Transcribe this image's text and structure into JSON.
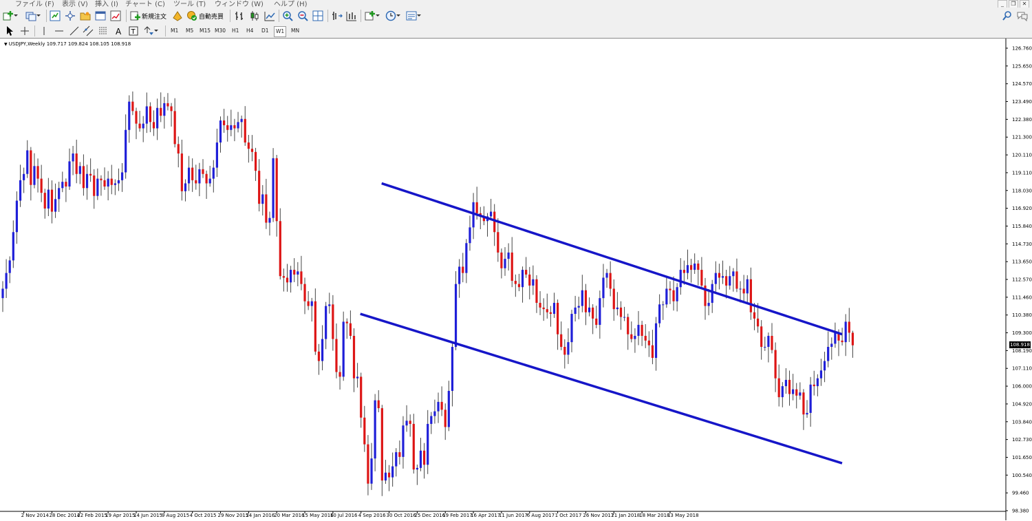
{
  "menu": [
    "ファイル (F)",
    "表示 (V)",
    "挿入 (I)",
    "チャート (C)",
    "ツール (T)",
    "ウィンドウ (W)",
    "ヘルプ (H)"
  ],
  "toolbar": {
    "new_order_label": "新規注文",
    "auto_trade_label": "自動売買"
  },
  "timeframes": [
    "M1",
    "M5",
    "M15",
    "M30",
    "H1",
    "H4",
    "D1",
    "W1",
    "MN"
  ],
  "active_timeframe": "W1",
  "chart_header": "USDJPY,Weekly  109.717 109.824 108.105 108.918",
  "current_price_label": "108.918",
  "colors": {
    "bull": "#1f1fd8",
    "bear": "#dd1515",
    "wick": "#444444",
    "channel": "#1616c8",
    "price_tag_bg": "#000000"
  },
  "chart_data": {
    "type": "candlestick",
    "symbol": "USDJPY",
    "timeframe": "Weekly",
    "last_bar": {
      "open": 109.717,
      "high": 109.824,
      "low": 108.105,
      "close": 108.918
    },
    "current_price": 108.918,
    "ylim": [
      98.38,
      127.8
    ],
    "y_ticks": [
      "126.760",
      "125.650",
      "124.570",
      "123.490",
      "122.380",
      "121.300",
      "120.110",
      "119.110",
      "118.030",
      "116.920",
      "115.840",
      "114.730",
      "113.650",
      "112.570",
      "111.460",
      "110.380",
      "109.300",
      "108.190",
      "107.110",
      "106.000",
      "104.920",
      "103.840",
      "102.730",
      "101.650",
      "100.540",
      "99.460",
      "98.380"
    ],
    "x_ticks": [
      "2 Nov 2014",
      "28 Dec 2014",
      "22 Feb 2015",
      "19 Apr 2015",
      "14 Jun 2015",
      "9 Aug 2015",
      "4 Oct 2015",
      "29 Nov 2015",
      "24 Jan 2016",
      "20 Mar 2016",
      "15 May 2016",
      "10 Jul 2016",
      "4 Sep 2016",
      "30 Oct 2016",
      "25 Dec 2016",
      "19 Feb 2017",
      "16 Apr 2017",
      "11 Jun 2017",
      "6 Aug 2017",
      "1 Oct 2017",
      "26 Nov 2017",
      "21 Jan 2018",
      "18 Mar 2018",
      "13 May 2018"
    ],
    "closes": [
      112.5,
      113.5,
      114.3,
      116.1,
      118.1,
      119.4,
      119.8,
      121.3,
      119.1,
      120.3,
      119.5,
      118.6,
      117.6,
      118.8,
      117.4,
      118.2,
      118.9,
      119.3,
      119.0,
      120.6,
      121.1,
      119.8,
      120.3,
      118.9,
      119.8,
      119.7,
      118.4,
      119.5,
      119.4,
      119.0,
      119.5,
      119.1,
      119.2,
      119.4,
      119.9,
      122.6,
      124.4,
      123.8,
      123.0,
      122.7,
      123.0,
      124.1,
      123.1,
      122.7,
      124.0,
      123.5,
      124.3,
      124.1,
      123.8,
      121.7,
      121.1,
      118.7,
      119.2,
      120.2,
      119.4,
      119.2,
      120.1,
      119.8,
      119.2,
      119.5,
      120.2,
      121.8,
      123.2,
      122.9,
      122.6,
      122.9,
      122.7,
      123.1,
      123.3,
      121.8,
      121.4,
      121.2,
      120.0,
      117.9,
      118.5,
      116.7,
      117.0,
      120.8,
      116.8,
      113.3,
      113.2,
      112.9,
      113.7,
      113.4,
      113.6,
      112.8,
      111.7,
      111.4,
      111.7,
      108.5,
      107.9,
      109.3,
      111.4,
      111.5,
      109.3,
      107.2,
      106.9,
      110.4,
      110.3,
      109.5,
      106.8,
      106.9,
      104.3,
      102.6,
      100.1,
      101.7,
      105.4,
      104.9,
      100.3,
      100.8,
      100.5,
      101.2,
      102.1,
      101.8,
      103.8,
      104.1,
      103.9,
      101.0,
      101.1,
      102.2,
      101.3,
      103.9,
      104.4,
      104.7,
      105.3,
      104.8,
      103.7,
      106.0,
      108.8,
      112.8,
      113.9,
      113.5,
      115.4,
      116.4,
      118.0,
      117.3,
      117.1,
      116.8,
      117.1,
      117.4,
      116.1,
      114.8,
      113.8,
      114.4,
      114.8,
      113.0,
      112.8,
      112.6,
      113.7,
      113.4,
      112.7,
      113.1,
      111.6,
      111.3,
      111.2,
      111.0,
      110.9,
      111.6,
      109.6,
      108.8,
      108.3,
      109.1,
      110.9,
      111.3,
      111.4,
      112.4,
      111.0,
      111.3,
      110.6,
      110.2,
      111.9,
      113.2,
      113.5,
      112.5,
      111.2,
      111.3,
      110.7,
      110.7,
      109.6,
      109.3,
      109.5,
      110.2,
      109.5,
      109.2,
      108.9,
      108.1,
      110.3,
      111.5,
      111.5,
      112.5,
      112.4,
      111.7,
      112.6,
      113.7,
      113.5,
      114.0,
      113.7,
      114.1,
      113.7,
      112.7,
      111.4,
      111.6,
      112.8,
      113.5,
      113.2,
      113.3,
      112.7,
      113.3,
      113.6,
      112.5,
      112.5,
      112.2,
      113.1,
      111.0,
      110.6,
      110.1,
      108.8,
      108.8,
      109.5,
      108.6,
      106.8,
      105.6,
      106.3,
      106.7,
      105.8,
      106.1,
      105.7,
      105.9,
      104.5,
      104.6,
      106.4,
      106.3,
      106.8,
      107.3,
      107.9,
      108.8,
      109.0,
      109.7,
      109.2,
      109.1,
      110.4,
      109.7,
      108.9
    ]
  },
  "channel": {
    "upper": {
      "start": "4 Sep 2016",
      "start_value": 119.2,
      "end": "13 May 2018",
      "end_value": 109.6
    },
    "lower": {
      "start": "4 Sep 2016",
      "start_value": 110.9,
      "end": "13 May 2018",
      "end_value": 101.4
    }
  }
}
